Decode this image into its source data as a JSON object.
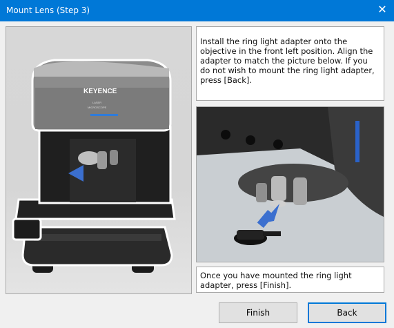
{
  "window": {
    "title": "Mount Lens (Step 3)",
    "close_glyph": "✕"
  },
  "device_image": {
    "brand_text": "KEYENCE",
    "badge_line1": "LASER",
    "badge_line2": "MICROSCOPE"
  },
  "instruction_text": "Install the ring light adapter onto the objective in the front left position. Align the adapter to match the picture below. If you do not wish to mount the ring light adapter, press [Back].",
  "footer_text": "Once you have mounted the ring light adapter, press [Finish].",
  "buttons": {
    "finish_label": "Finish",
    "back_label": "Back"
  },
  "colors": {
    "titlebar": "#0078d7",
    "arrow": "#3b6fcf"
  }
}
